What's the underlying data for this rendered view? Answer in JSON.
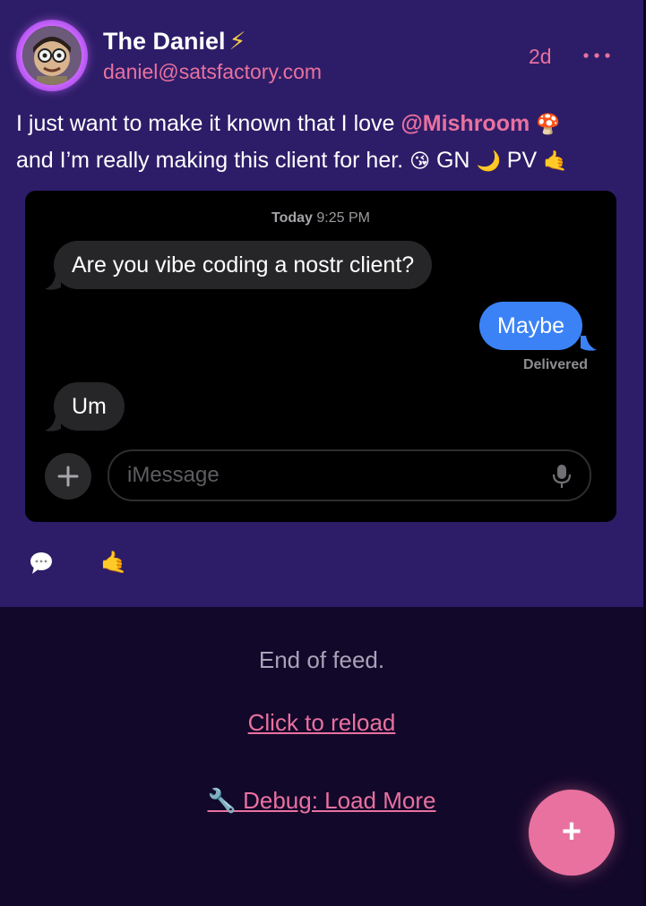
{
  "post": {
    "author_name": "The Daniel",
    "author_badge": "⚡",
    "author_nip05": "daniel@satsfactory.com",
    "timestamp": "2d",
    "more_icon": "ellipsis-horizontal-icon",
    "text_before": "I just want to make it known that I love ",
    "mention": "@Mishroom",
    "mention_emoji": "🍄",
    "text_line2": "and I’m really making this client for her.",
    "emoji_kiss": "😘",
    "word_gn": "GN",
    "emoji_moon": "🌙",
    "word_pv": "PV",
    "emoji_shaka": "🤙"
  },
  "media": {
    "time_day": "Today",
    "time_clock": "9:25 PM",
    "messages": [
      {
        "direction": "incoming",
        "text": "Are you vibe coding a nostr client?"
      },
      {
        "direction": "outgoing",
        "text": "Maybe"
      },
      {
        "direction": "incoming",
        "text": "Um"
      }
    ],
    "delivered_label": "Delivered",
    "input_placeholder": "iMessage",
    "plus_icon": "plus-icon",
    "mic_icon": "microphone-icon"
  },
  "actions": {
    "reply_icon": "speech-bubble-icon",
    "reaction_emoji": "🤙"
  },
  "feed_end": {
    "message": "End of feed.",
    "reload_label": "Click to reload",
    "debug_label": "🔧 Debug: Load More"
  },
  "fab": {
    "label": "+"
  },
  "colors": {
    "post_bg": "#2d1d68",
    "page_bg": "#12082a",
    "accent_pink": "#e9719f",
    "imessage_blue": "#3b82f6"
  }
}
